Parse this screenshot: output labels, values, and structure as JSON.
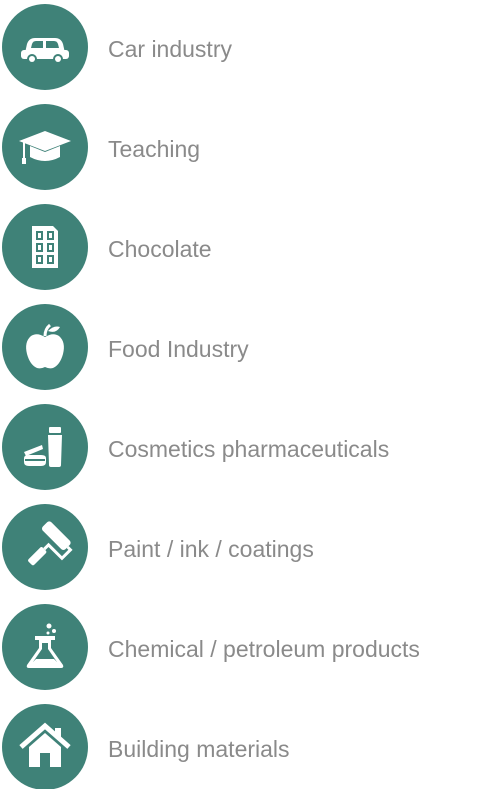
{
  "accent_color": "#3f8278",
  "text_color": "#8a8a8a",
  "items": [
    {
      "label": "Car industry",
      "icon": "car-icon"
    },
    {
      "label": "Teaching",
      "icon": "graduation-cap-icon"
    },
    {
      "label": "Chocolate",
      "icon": "chocolate-bar-icon"
    },
    {
      "label": "Food Industry",
      "icon": "apple-icon"
    },
    {
      "label": "Cosmetics pharmaceuticals",
      "icon": "cosmetics-icon"
    },
    {
      "label": "Paint / ink / coatings",
      "icon": "paint-roller-icon"
    },
    {
      "label": "Chemical / petroleum products",
      "icon": "flask-icon"
    },
    {
      "label": "Building materials",
      "icon": "house-icon"
    }
  ]
}
